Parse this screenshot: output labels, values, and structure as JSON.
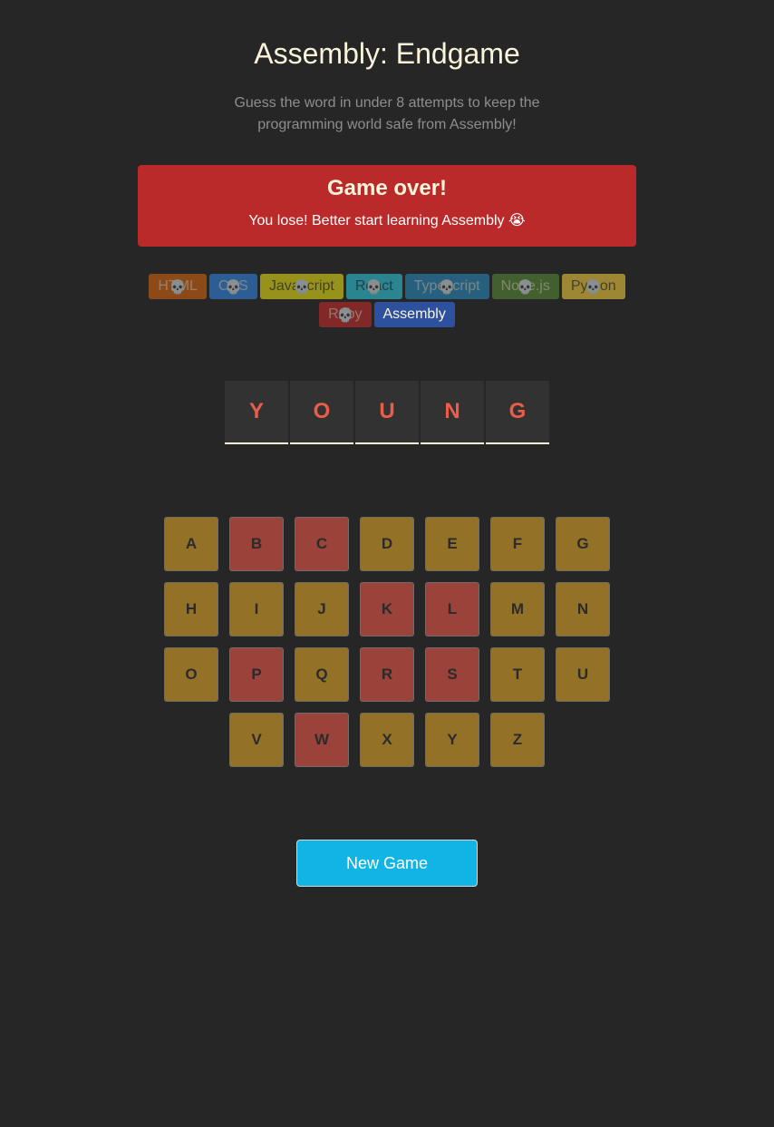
{
  "header": {
    "title": "Assembly: Endgame",
    "subtitle": "Guess the word in under 8 attempts to keep the programming world safe from Assembly!"
  },
  "status": {
    "title": "Game over!",
    "message": "You lose! Better start learning Assembly 😭"
  },
  "languages": [
    {
      "name": "HTML",
      "bg": "#E2680F",
      "color": "#F9F4DA",
      "lost": true
    },
    {
      "name": "CSS",
      "bg": "#328AF1",
      "color": "#F9F4DA",
      "lost": true
    },
    {
      "name": "Javascript",
      "bg": "#F4EB13",
      "color": "#1E1E1E",
      "lost": true
    },
    {
      "name": "React",
      "bg": "#2ED3E9",
      "color": "#1E1E1E",
      "lost": true
    },
    {
      "name": "Typescript",
      "bg": "#298EC6",
      "color": "#F9F4DA",
      "lost": true
    },
    {
      "name": "Node.js",
      "bg": "#599137",
      "color": "#F9F4DA",
      "lost": true
    },
    {
      "name": "Python",
      "bg": "#FFD742",
      "color": "#1E1E1E",
      "lost": true
    },
    {
      "name": "Ruby",
      "bg": "#D02B2B",
      "color": "#F9F4DA",
      "lost": true
    },
    {
      "name": "Assembly",
      "bg": "#2D519F",
      "color": "#F9F4DA",
      "lost": false
    }
  ],
  "skull_icon": "💀",
  "word": [
    "Y",
    "O",
    "U",
    "N",
    "G"
  ],
  "keyboard": [
    {
      "letter": "A",
      "state": "unused"
    },
    {
      "letter": "B",
      "state": "wrong"
    },
    {
      "letter": "C",
      "state": "wrong"
    },
    {
      "letter": "D",
      "state": "unused"
    },
    {
      "letter": "E",
      "state": "unused"
    },
    {
      "letter": "F",
      "state": "unused"
    },
    {
      "letter": "G",
      "state": "unused"
    },
    {
      "letter": "H",
      "state": "unused"
    },
    {
      "letter": "I",
      "state": "unused"
    },
    {
      "letter": "J",
      "state": "unused"
    },
    {
      "letter": "K",
      "state": "wrong"
    },
    {
      "letter": "L",
      "state": "wrong"
    },
    {
      "letter": "M",
      "state": "unused"
    },
    {
      "letter": "N",
      "state": "unused"
    },
    {
      "letter": "O",
      "state": "unused"
    },
    {
      "letter": "P",
      "state": "wrong"
    },
    {
      "letter": "Q",
      "state": "unused"
    },
    {
      "letter": "R",
      "state": "wrong"
    },
    {
      "letter": "S",
      "state": "wrong"
    },
    {
      "letter": "T",
      "state": "unused"
    },
    {
      "letter": "U",
      "state": "unused"
    },
    {
      "letter": "V",
      "state": "unused"
    },
    {
      "letter": "W",
      "state": "wrong"
    },
    {
      "letter": "X",
      "state": "unused"
    },
    {
      "letter": "Y",
      "state": "unused"
    },
    {
      "letter": "Z",
      "state": "unused"
    }
  ],
  "new_game_label": "New Game"
}
